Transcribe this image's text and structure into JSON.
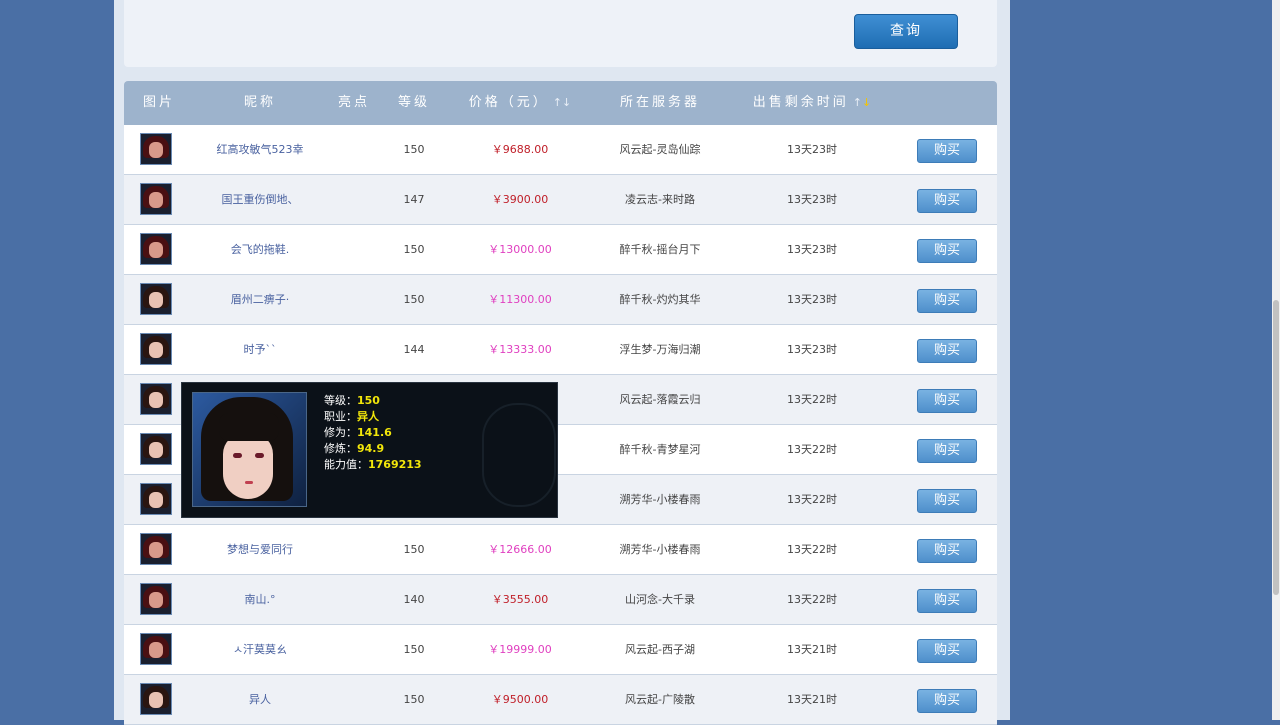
{
  "search": {
    "query_button": "查询"
  },
  "table": {
    "headers": [
      "图片",
      "昵称",
      "亮点",
      "等级",
      "价格（元）",
      "所在服务器",
      "出售剩余时间"
    ],
    "price_sort": "↑↓",
    "time_sort_up": "↑",
    "time_sort_down": "↓",
    "buy_label": "购买",
    "rows": [
      {
        "avatar": "male",
        "name": "红高攻敏气523幸",
        "level": "150",
        "price": "￥9688.00",
        "price_color": "red",
        "server": "风云起-灵岛仙踪",
        "time": "13天23时"
      },
      {
        "avatar": "male",
        "name": "国王重伤倒地、",
        "level": "147",
        "price": "￥3900.00",
        "price_color": "red",
        "server": "凌云志-来时路",
        "time": "13天23时"
      },
      {
        "avatar": "male",
        "name": "会飞的拖鞋.",
        "level": "150",
        "price": "￥13000.00",
        "price_color": "pink",
        "server": "醉千秋-摇台月下",
        "time": "13天23时"
      },
      {
        "avatar": "female",
        "name": "眉州二痹子·",
        "level": "150",
        "price": "￥11300.00",
        "price_color": "pink",
        "server": "醉千秋-灼灼其华",
        "time": "13天23时"
      },
      {
        "avatar": "female",
        "name": "时予``",
        "level": "144",
        "price": "￥13333.00",
        "price_color": "pink",
        "server": "浮生梦-万海归潮",
        "time": "13天23时"
      },
      {
        "avatar": "female",
        "name": "",
        "level": "",
        "price": "",
        "price_color": "red",
        "server": "风云起-落霞云归",
        "time": "13天22时"
      },
      {
        "avatar": "female",
        "name": "",
        "level": "",
        "price": "",
        "price_color": "red",
        "server": "醉千秋-青梦星河",
        "time": "13天22时"
      },
      {
        "avatar": "female",
        "name": "",
        "level": "",
        "price": "",
        "price_color": "red",
        "server": "溯芳华-小楼春雨",
        "time": "13天22时"
      },
      {
        "avatar": "male",
        "name": "梦想与爱同行",
        "level": "150",
        "price": "￥12666.00",
        "price_color": "pink",
        "server": "溯芳华-小楼春雨",
        "time": "13天22时"
      },
      {
        "avatar": "male",
        "name": "南山.°",
        "level": "140",
        "price": "￥3555.00",
        "price_color": "red",
        "server": "山河念-大千录",
        "time": "13天22时"
      },
      {
        "avatar": "male",
        "name": "ㅅ汗莫莫ㄠ",
        "level": "150",
        "price": "￥19999.00",
        "price_color": "pink",
        "server": "风云起-西子湖",
        "time": "13天21时"
      },
      {
        "avatar": "female",
        "name": "异人",
        "level": "150",
        "price": "￥9500.00",
        "price_color": "red",
        "server": "风云起-广陵散",
        "time": "13天21时"
      }
    ]
  },
  "popup": {
    "level_label": "等级：",
    "level": "150",
    "job_label": "职业：",
    "job": "异人",
    "cultivation_label": "修为：",
    "cultivation": "141.6",
    "training_label": "修炼：",
    "training": "94.9",
    "ability_label": "能力值：",
    "ability": "1769213"
  },
  "colors": {
    "page_bg": "#4a6fa5",
    "header_bg": "#9db3cc",
    "price_red": "#c0202a",
    "price_pink": "#e040c0",
    "stat_yellow": "#f2e60a"
  }
}
